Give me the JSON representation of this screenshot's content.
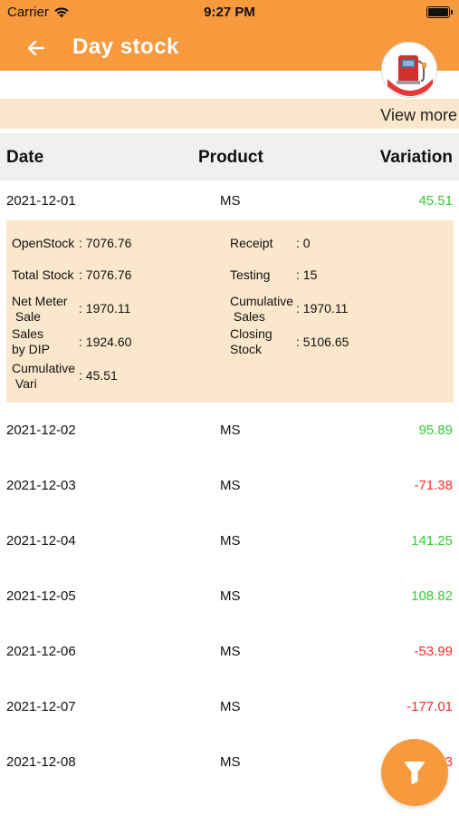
{
  "status_bar": {
    "carrier": "Carrier",
    "time": "9:27 PM"
  },
  "header": {
    "title": "Day stock",
    "background": "#f79a3e"
  },
  "view_more": "View more",
  "columns": {
    "date": "Date",
    "product": "Product",
    "variation": "Variation"
  },
  "rows": [
    {
      "date": "2021-12-01",
      "product": "MS",
      "variation": "45.51"
    },
    {
      "date": "2021-12-02",
      "product": "MS",
      "variation": "95.89"
    },
    {
      "date": "2021-12-03",
      "product": "MS",
      "variation": "-71.38"
    },
    {
      "date": "2021-12-04",
      "product": "MS",
      "variation": "141.25"
    },
    {
      "date": "2021-12-05",
      "product": "MS",
      "variation": "108.82"
    },
    {
      "date": "2021-12-06",
      "product": "MS",
      "variation": "-53.99"
    },
    {
      "date": "2021-12-07",
      "product": "MS",
      "variation": "-177.01"
    },
    {
      "date": "2021-12-08",
      "product": "MS",
      "variation": "3"
    }
  ],
  "expanded_detail": {
    "open_stock": {
      "label": "OpenStock",
      "value": "7076.76"
    },
    "receipt": {
      "label": "Receipt",
      "value": "0"
    },
    "total_stock": {
      "label": "Total Stock",
      "value": "7076.76"
    },
    "testing": {
      "label": "Testing",
      "value": "15"
    },
    "net_meter_sale": {
      "label_line1": "Net Meter",
      "label_line2": "Sale",
      "value": "1970.11"
    },
    "cumulative_sales": {
      "label_line1": "Cumulative",
      "label_line2": "Sales",
      "value": "1970.11"
    },
    "sales_by_dip": {
      "label_line1": "Sales",
      "label_line2": "by DIP",
      "value": "1924.60"
    },
    "closing_stock": {
      "label_line1": "Closing",
      "label_line2": "Stock",
      "value": "5106.65"
    },
    "cumulative_vari": {
      "label_line1": "Cumulative",
      "label_line2": "Vari",
      "value": "45.51"
    }
  },
  "colors": {
    "accent": "#f79a3e",
    "detail_bg": "#fbe7cc",
    "positive": "#33cc33",
    "negative": "#ff2b2b"
  },
  "icons": {
    "back": "arrow-left-icon",
    "filter": "filter-funnel-icon",
    "logo": "fuel-pump-logo"
  }
}
